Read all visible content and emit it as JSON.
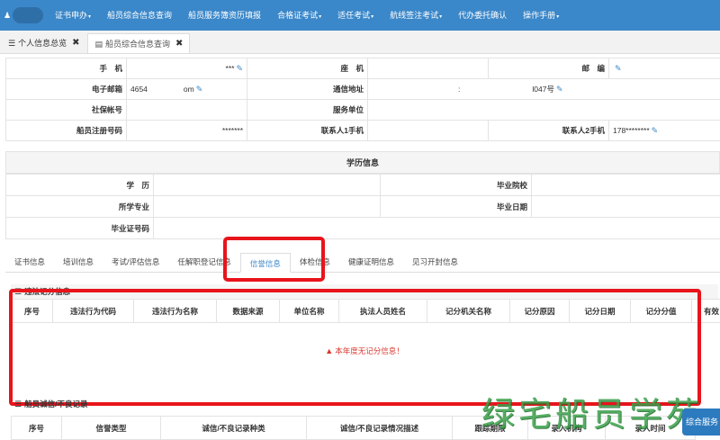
{
  "nav": {
    "items": [
      {
        "label": "证书申办",
        "caret": true
      },
      {
        "label": "船员综合信息查询",
        "caret": false
      },
      {
        "label": "船员服务簿资历填报",
        "caret": false
      },
      {
        "label": "合格证考试",
        "caret": true
      },
      {
        "label": "适任考试",
        "caret": true
      },
      {
        "label": "航线签注考试",
        "caret": true
      },
      {
        "label": "代办委托确认",
        "caret": false
      },
      {
        "label": "操作手册",
        "caret": true
      }
    ],
    "caret_glyph": "▾"
  },
  "tabs": [
    {
      "label": "个人信息总览",
      "icon": "list-icon"
    },
    {
      "label": "船员综合信息查询",
      "icon": "card-icon"
    }
  ],
  "contact": {
    "rows": [
      [
        {
          "label": "手　机",
          "value": "***"
        },
        {
          "label": "座　机",
          "value": ""
        },
        {
          "label": "邮　编",
          "value": ""
        }
      ],
      [
        {
          "label": "电子邮箱",
          "value": "4654",
          "value2": "om"
        },
        {
          "label": "通信地址",
          "value": ":",
          "value2": "l047号"
        }
      ],
      [
        {
          "label": "社保帐号",
          "value": ""
        },
        {
          "label": "服务单位",
          "value": ""
        }
      ],
      [
        {
          "label": "船员注册号码",
          "value": "*******"
        },
        {
          "label": "联系人1手机",
          "value": ""
        },
        {
          "label": "联系人2手机",
          "value": "178********"
        }
      ]
    ]
  },
  "education": {
    "header": "学历信息",
    "rows": [
      [
        {
          "label": "学　历",
          "value": ""
        },
        {
          "label": "毕业院校",
          "value": ""
        }
      ],
      [
        {
          "label": "所学专业",
          "value": ""
        },
        {
          "label": "毕业日期",
          "value": ""
        }
      ],
      [
        {
          "label": "毕业证号码",
          "value": ""
        }
      ]
    ]
  },
  "subtabs": [
    "证书信息",
    "培训信息",
    "考试/评估信息",
    "任解职登记信息",
    "信誉信息",
    "体检信息",
    "健康证明信息",
    "见习开封信息"
  ],
  "active_subtab": "信誉信息",
  "violation": {
    "title": "违法记分信息",
    "columns": [
      "序号",
      "违法行为代码",
      "违法行为名称",
      "数据来源",
      "单位名称",
      "执法人员姓名",
      "记分机关名称",
      "记分原因",
      "记分日期",
      "记分分值",
      "有效"
    ],
    "empty_message": "本年度无记分信息！"
  },
  "integrity": {
    "title": "船员诚信/不良记录",
    "columns": [
      "序号",
      "信誉类型",
      "诚信/不良记录种类",
      "诚信/不良记录情况描述",
      "跟踪期限",
      "录入机构",
      "录入时间"
    ]
  },
  "watermark": "绿宅船员学苑",
  "float_button": "综合服务",
  "colors": {
    "nav": "#3a87c9",
    "highlight": "#e8141b",
    "warning": "#d9342b",
    "watermark": "#3aa04a"
  }
}
